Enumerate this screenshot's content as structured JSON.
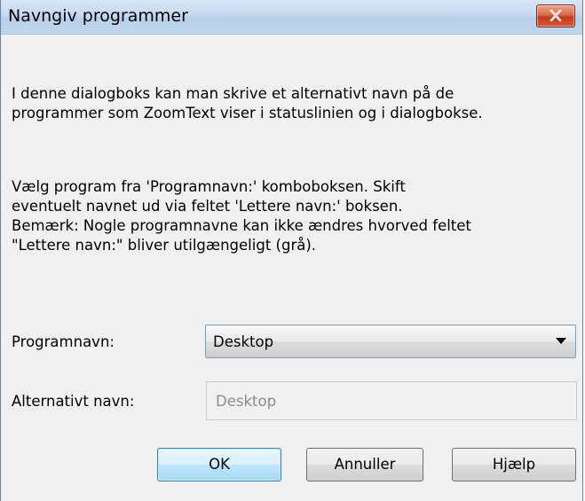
{
  "window": {
    "title": "Navngiv programmer"
  },
  "content": {
    "paragraph1": "I denne dialogboks kan man skrive et alternativt navn på de\nprogrammer som ZoomText viser i statuslinien og i dialogbokse.",
    "paragraph2": "Vælg program fra 'Programnavn:' komboboksen.  Skift\neventuelt navnet ud via feltet 'Lettere navn:' boksen.\nBemærk: Nogle programnavne kan ikke ændres hvorved feltet\n\"Lettere navn:\" bliver utilgængeligt (grå)."
  },
  "form": {
    "program_label": "Programnavn:",
    "program_value": "Desktop",
    "alt_label": "Alternativt navn:",
    "alt_value": "Desktop"
  },
  "buttons": {
    "ok": "OK",
    "cancel": "Annuller",
    "help": "Hjælp"
  },
  "icons": {
    "close": "close-icon",
    "dropdown": "chevron-down-icon"
  }
}
